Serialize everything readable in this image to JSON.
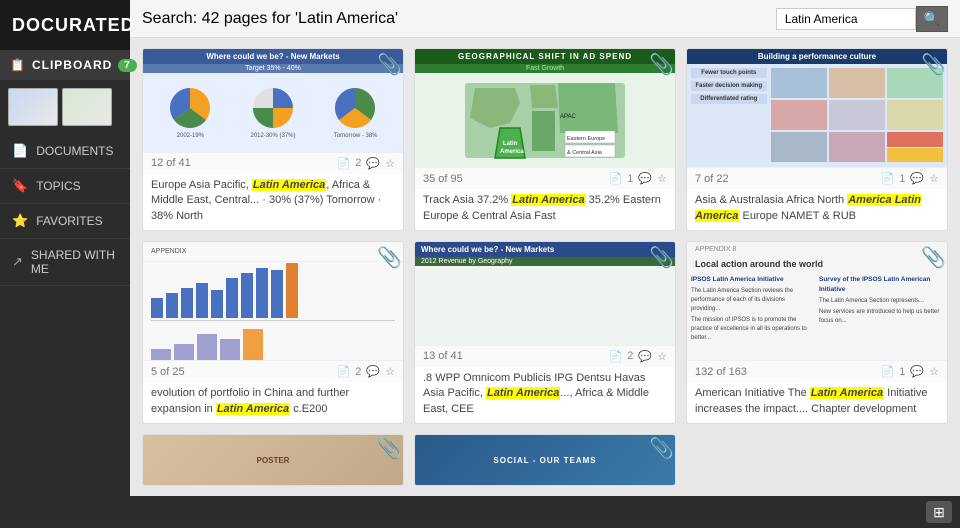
{
  "logo": "DOCURATED",
  "topbar": {
    "search_info": "Search: 42 pages for 'Latin America'",
    "search_placeholder": "Latin America",
    "search_button_icon": "🔍"
  },
  "sidebar": {
    "clipboard_label": "CLIPBOARD",
    "clipboard_badge": "7",
    "nav_items": [
      {
        "label": "DOCUMENTS",
        "icon": "📄"
      },
      {
        "label": "TOPICS",
        "icon": "🔖"
      },
      {
        "label": "FAVORITES",
        "icon": "⭐"
      },
      {
        "label": "SHARED WITH ME",
        "icon": "↗"
      }
    ]
  },
  "cards": [
    {
      "id": "card-1",
      "title_line1": "Where could we be? - New Markets",
      "title_line2": "Target 35% - 40%",
      "page": "12 of 41",
      "comment_count": "2",
      "starred": false,
      "description": "Europe Asia Pacific, Latin America, Africa & Middle East, Central... · 30% (37%) Tomorrow · 38% North",
      "highlight_word": "Latin America"
    },
    {
      "id": "card-2",
      "title_line1": "GEOGRAPHICAL SHIFT IN AD SPEND",
      "title_line2": "Fast Growth",
      "page": "35 of 95",
      "comment_count": "1",
      "starred": false,
      "description": "Track Asia 37.2% Latin America 35.2% Eastern Europe & Central Asia Fast",
      "highlight_word": "Latin America"
    },
    {
      "id": "card-3",
      "title_line1": "Building a performance culture",
      "page": "7 of 22",
      "comment_count": "1",
      "starred": false,
      "description": "Asia & Australasia Africa North America Latin America Europe NAMET & RUB",
      "highlight_word": "Latin America"
    },
    {
      "id": "card-4",
      "title_line1": "(bar chart slide)",
      "page": "5 of 25",
      "comment_count": "2",
      "starred": false,
      "description": "evolution of portfolio in China and further expansion in Latin America c.E200",
      "highlight_word": "Latin America"
    },
    {
      "id": "card-5",
      "title_line1": "Where could we be? - New Markets",
      "title_line2": "2012 Revenue by Geography",
      "page": "13 of 41",
      "comment_count": "2",
      "starred": false,
      "description": ".8 WPP Omnicom Publicis IPG Dentsu Havas Asia Pacific, Latin America..., Africa & Middle East, CEE",
      "highlight_word": "Latin America"
    },
    {
      "id": "card-6",
      "title_line1": "APPENDIX 8 Local action around the world",
      "page": "132 of 163",
      "comment_count": "1",
      "starred": false,
      "description": "American Initiative The Latin America Initiative increases the impact.... Chapter development",
      "highlight_word": "Latin America"
    },
    {
      "id": "card-7",
      "title_line1": "(poster slide)",
      "page": "",
      "comment_count": "",
      "starred": false,
      "description": ""
    },
    {
      "id": "card-8",
      "title_line1": "SOCIAL - OUR TEAMS",
      "page": "",
      "comment_count": "",
      "starred": false,
      "description": ""
    }
  ],
  "colors": {
    "sidebar_bg": "#2c2c2c",
    "highlight_yellow": "#ffff00",
    "accent_green": "#4caf50"
  }
}
